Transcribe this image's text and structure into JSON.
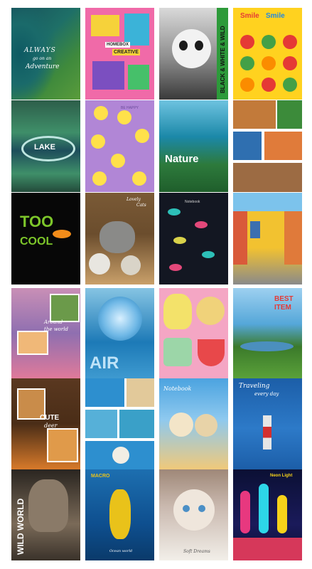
{
  "sheet_1": {
    "covers": [
      {
        "id": "forest-adventure",
        "lines": [
          "ALWAYS",
          "go on an",
          "Adventure"
        ],
        "colors": [
          "#1d6f66",
          "#4d8d3a"
        ]
      },
      {
        "id": "colorful-abstract",
        "lines": [
          "HOMEBOX",
          "CREATIVE"
        ],
        "colors": [
          "#f06aa8",
          "#3bb3d8"
        ]
      },
      {
        "id": "panda-bw",
        "lines": [
          "BLACK & WHITE & WILD"
        ],
        "colors": [
          "#e8e8e8",
          "#2e2e2e"
        ]
      },
      {
        "id": "smile-smile",
        "lines": [
          "Smile",
          "Smile"
        ],
        "colors": [
          "#ffd21f",
          "#e53935"
        ]
      },
      {
        "id": "lake",
        "lines": [
          "LAKE"
        ],
        "colors": [
          "#1e4e5b",
          "#3f8f69"
        ]
      },
      {
        "id": "ducks",
        "lines": [
          "BE HAPPY"
        ],
        "colors": [
          "#b186d6",
          "#ffe14a"
        ]
      },
      {
        "id": "nature",
        "lines": [
          "Nature"
        ],
        "colors": [
          "#1b88a8",
          "#1f5e2b"
        ]
      },
      {
        "id": "animal-collage",
        "lines": [],
        "colors": [
          "#3c8b3a",
          "#e07b3a"
        ]
      },
      {
        "id": "toucan",
        "lines": [
          "TOO",
          "COOL"
        ],
        "colors": [
          "#070707",
          "#7dc62a"
        ]
      },
      {
        "id": "cats",
        "lines": [
          "Lovely",
          "Cats"
        ],
        "colors": [
          "#6b4d2d",
          "#c9a06a"
        ]
      },
      {
        "id": "butterflies",
        "lines": [
          "Notebook"
        ],
        "colors": [
          "#131722",
          "#d9d24a"
        ]
      },
      {
        "id": "street",
        "lines": [],
        "colors": [
          "#f2c230",
          "#d95a3a"
        ]
      }
    ]
  },
  "sheet_2": {
    "covers": [
      {
        "id": "lavender",
        "lines": [
          "Around",
          "the world"
        ],
        "colors": [
          "#8f6fb0",
          "#e07a9a"
        ]
      },
      {
        "id": "jellyfish-air",
        "lines": [
          "AIR"
        ],
        "colors": [
          "#1d7ab7",
          "#86c4e3"
        ]
      },
      {
        "id": "fruits",
        "lines": [],
        "colors": [
          "#f4a6c4",
          "#f3e26a"
        ]
      },
      {
        "id": "best-item",
        "lines": [
          "BEST",
          "ITEM"
        ],
        "colors": [
          "#55a7d9",
          "#5aa13a"
        ]
      },
      {
        "id": "cute-deer",
        "lines": [
          "CUTE",
          "deer"
        ],
        "colors": [
          "#4a2d17",
          "#d87a2a"
        ]
      },
      {
        "id": "beach-collage",
        "lines": [],
        "colors": [
          "#2d8fcf",
          "#e2c99a"
        ]
      },
      {
        "id": "notebook-cats",
        "lines": [
          "Notebook"
        ],
        "colors": [
          "#4ba3e0",
          "#f0c97a"
        ]
      },
      {
        "id": "lighthouse",
        "lines": [
          "Traveling",
          "every day"
        ],
        "colors": [
          "#1c5ea8",
          "#e6e6e6"
        ]
      },
      {
        "id": "wild-world",
        "lines": [
          "WILD WORLD"
        ],
        "colors": [
          "#2a2520",
          "#7a6a58"
        ]
      },
      {
        "id": "macro-seahorse",
        "lines": [
          "MACRO",
          "Ocean world"
        ],
        "colors": [
          "#0e4f8f",
          "#e9c21a"
        ]
      },
      {
        "id": "kitten",
        "lines": [
          "Soft Dreams"
        ],
        "colors": [
          "#c9b8ae",
          "#f2efe9"
        ]
      },
      {
        "id": "neon-light",
        "lines": [
          "Neon Light"
        ],
        "colors": [
          "#0b1034",
          "#e8387f"
        ]
      }
    ]
  }
}
